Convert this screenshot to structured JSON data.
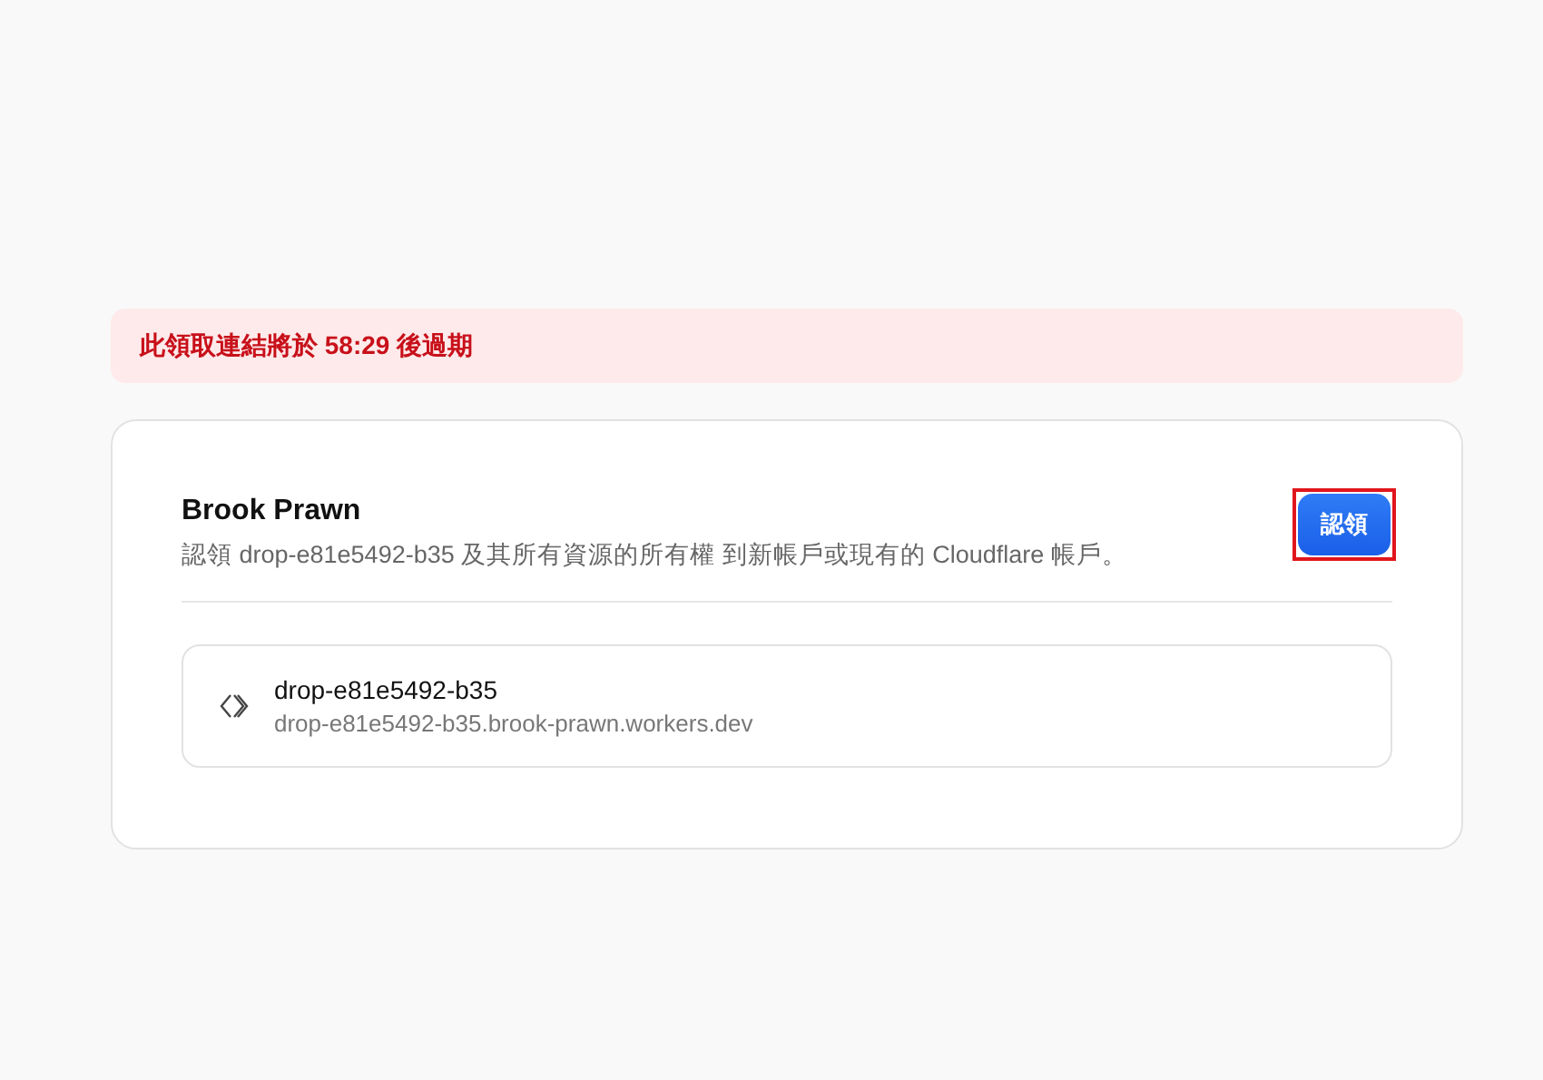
{
  "alert": {
    "text": "此領取連結將於 58:29 後過期"
  },
  "claim": {
    "title": "Brook Prawn",
    "description": "認領 drop-e81e5492-b35 及其所有資源的所有權 到新帳戶或現有的 Cloudflare 帳戶。",
    "button": {
      "label": "認領",
      "highlighted": true
    }
  },
  "worker": {
    "name": "drop-e81e5492-b35",
    "url": "drop-e81e5492-b35.brook-prawn.workers.dev"
  }
}
